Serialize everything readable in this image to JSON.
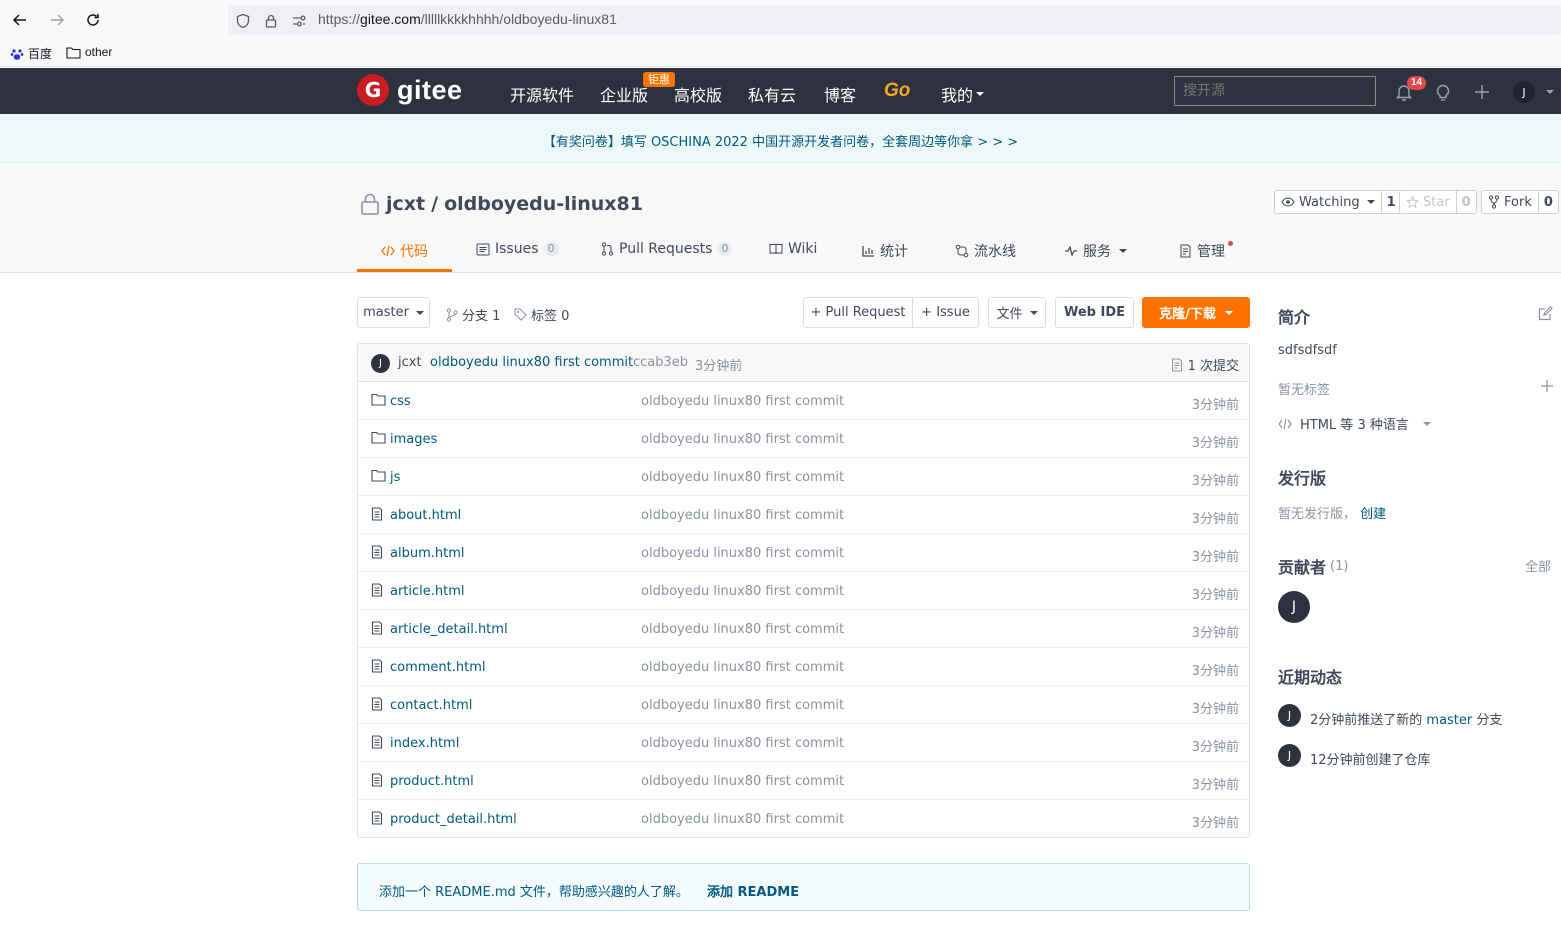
{
  "browser": {
    "url_prefix": "https://",
    "url_host": "gitee.com",
    "url_path": "/lllllkkkkhhhh/oldboyedu-linux81",
    "bookmarks": [
      {
        "label": "百度"
      },
      {
        "label": "other"
      }
    ]
  },
  "header": {
    "logo": "gitee",
    "nav": [
      "开源软件",
      "企业版",
      "高校版",
      "私有云",
      "博客",
      "Go",
      "我的"
    ],
    "promo_badge": "钜惠",
    "search_placeholder": "搜开源",
    "notification_count": "14",
    "avatar_letter": "J"
  },
  "banner": {
    "text": "【有奖问卷】填写 OSCHINA 2022 中国开源开发者问卷，全套周边等你拿 > > >"
  },
  "repo": {
    "owner": "jcxt",
    "separator": "/",
    "name": "oldboyedu-linux81",
    "watch_label": "Watching",
    "watch_count": "1",
    "star_label": "Star",
    "star_count": "0",
    "fork_label": "Fork",
    "fork_count": "0",
    "tabs": [
      {
        "label": "代码"
      },
      {
        "label": "Issues",
        "count": "0"
      },
      {
        "label": "Pull Requests",
        "count": "0"
      },
      {
        "label": "Wiki"
      },
      {
        "label": "统计"
      },
      {
        "label": "流水线"
      },
      {
        "label": "服务"
      },
      {
        "label": "管理"
      }
    ]
  },
  "toolbar": {
    "branch": "master",
    "branches": "分支 1",
    "tags": "标签 0",
    "pull_request": "+ Pull Request",
    "issue": "+ Issue",
    "file": "文件",
    "web_ide": "Web IDE",
    "clone": "克隆/下载"
  },
  "commit": {
    "avatar": "J",
    "author": "jcxt",
    "message": "oldboyedu linux80 first commit",
    "hash": "ccab3eb",
    "time": "3分钟前",
    "count_label": "1 次提交"
  },
  "files": [
    {
      "name": "css",
      "type": "folder",
      "message": "oldboyedu linux80 first commit",
      "time": "3分钟前"
    },
    {
      "name": "images",
      "type": "folder",
      "message": "oldboyedu linux80 first commit",
      "time": "3分钟前"
    },
    {
      "name": "js",
      "type": "folder",
      "message": "oldboyedu linux80 first commit",
      "time": "3分钟前"
    },
    {
      "name": "about.html",
      "type": "file",
      "message": "oldboyedu linux80 first commit",
      "time": "3分钟前"
    },
    {
      "name": "album.html",
      "type": "file",
      "message": "oldboyedu linux80 first commit",
      "time": "3分钟前"
    },
    {
      "name": "article.html",
      "type": "file",
      "message": "oldboyedu linux80 first commit",
      "time": "3分钟前"
    },
    {
      "name": "article_detail.html",
      "type": "file",
      "message": "oldboyedu linux80 first commit",
      "time": "3分钟前"
    },
    {
      "name": "comment.html",
      "type": "file",
      "message": "oldboyedu linux80 first commit",
      "time": "3分钟前"
    },
    {
      "name": "contact.html",
      "type": "file",
      "message": "oldboyedu linux80 first commit",
      "time": "3分钟前"
    },
    {
      "name": "index.html",
      "type": "file",
      "message": "oldboyedu linux80 first commit",
      "time": "3分钟前"
    },
    {
      "name": "product.html",
      "type": "file",
      "message": "oldboyedu linux80 first commit",
      "time": "3分钟前"
    },
    {
      "name": "product_detail.html",
      "type": "file",
      "message": "oldboyedu linux80 first commit",
      "time": "3分钟前"
    }
  ],
  "readme_tip": {
    "text": "添加一个 README.md 文件，帮助感兴趣的人了解。",
    "link": "添加 README"
  },
  "sidebar": {
    "intro_title": "简介",
    "description": "sdfsdfsdf",
    "no_tags": "暂无标签",
    "languages": "HTML 等 3 种语言",
    "releases_title": "发行版",
    "no_releases": "暂无发行版，",
    "create": "创建",
    "contributors_title": "贡献者",
    "contributors_count": "(1)",
    "all": "全部",
    "contributor_avatar": "J",
    "activity_title": "近期动态",
    "activities": [
      {
        "avatar": "J",
        "prefix": "2分钟前推送了新的 ",
        "branch": "master",
        "suffix": " 分支"
      },
      {
        "avatar": "J",
        "prefix": "12分钟前创建了仓库",
        "branch": "",
        "suffix": ""
      }
    ]
  },
  "colors": {
    "brand_orange": "#fe7300",
    "header_bg": "#2e323e",
    "link_blue": "#005980",
    "logo_red": "#c71d23"
  }
}
